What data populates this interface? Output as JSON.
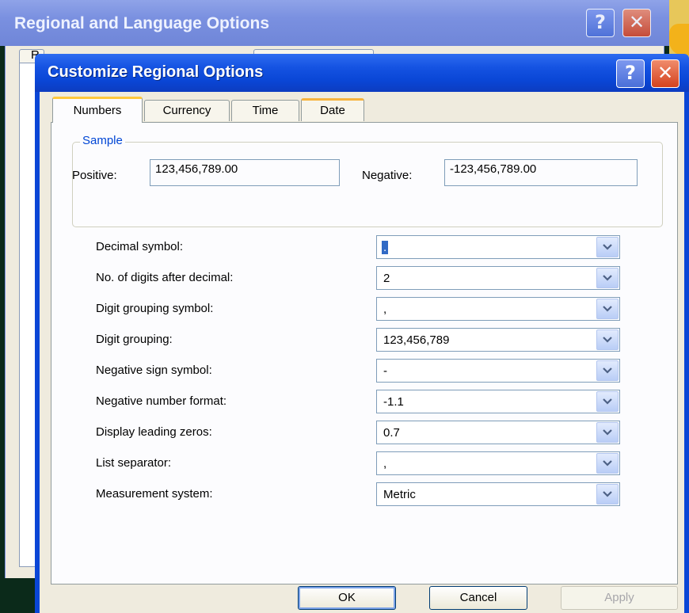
{
  "background_window": {
    "title": "Regional and Language Options",
    "tab_first_char": "R"
  },
  "title_buttons": {
    "help": "?",
    "close": "✕"
  },
  "dialog": {
    "title": "Customize Regional Options",
    "tabs": [
      {
        "label": "Numbers",
        "active": true
      },
      {
        "label": "Currency",
        "active": false
      },
      {
        "label": "Time",
        "active": false
      },
      {
        "label": "Date",
        "active": false
      }
    ],
    "sample": {
      "legend": "Sample",
      "positive_label": "Positive:",
      "positive_value": "123,456,789.00",
      "negative_label": "Negative:",
      "negative_value": "-123,456,789.00"
    },
    "settings": [
      {
        "label": "Decimal symbol:",
        "value": "."
      },
      {
        "label": "No. of digits after decimal:",
        "value": "2"
      },
      {
        "label": "Digit grouping symbol:",
        "value": ","
      },
      {
        "label": "Digit grouping:",
        "value": "123,456,789"
      },
      {
        "label": "Negative sign symbol:",
        "value": "-"
      },
      {
        "label": "Negative number format:",
        "value": "-1.1"
      },
      {
        "label": "Display leading zeros:",
        "value": "0.7"
      },
      {
        "label": "List separator:",
        "value": ","
      },
      {
        "label": "Measurement system:",
        "value": "Metric"
      }
    ],
    "buttons": {
      "ok": "OK",
      "cancel": "Cancel",
      "apply": "Apply"
    }
  },
  "colors": {
    "titlebar_active": "#0a46d6",
    "titlebar_inactive": "#7a90e0",
    "dialog_face": "#efebde",
    "group_legend": "#0046d5",
    "tab_highlight": "#ffc83c"
  }
}
